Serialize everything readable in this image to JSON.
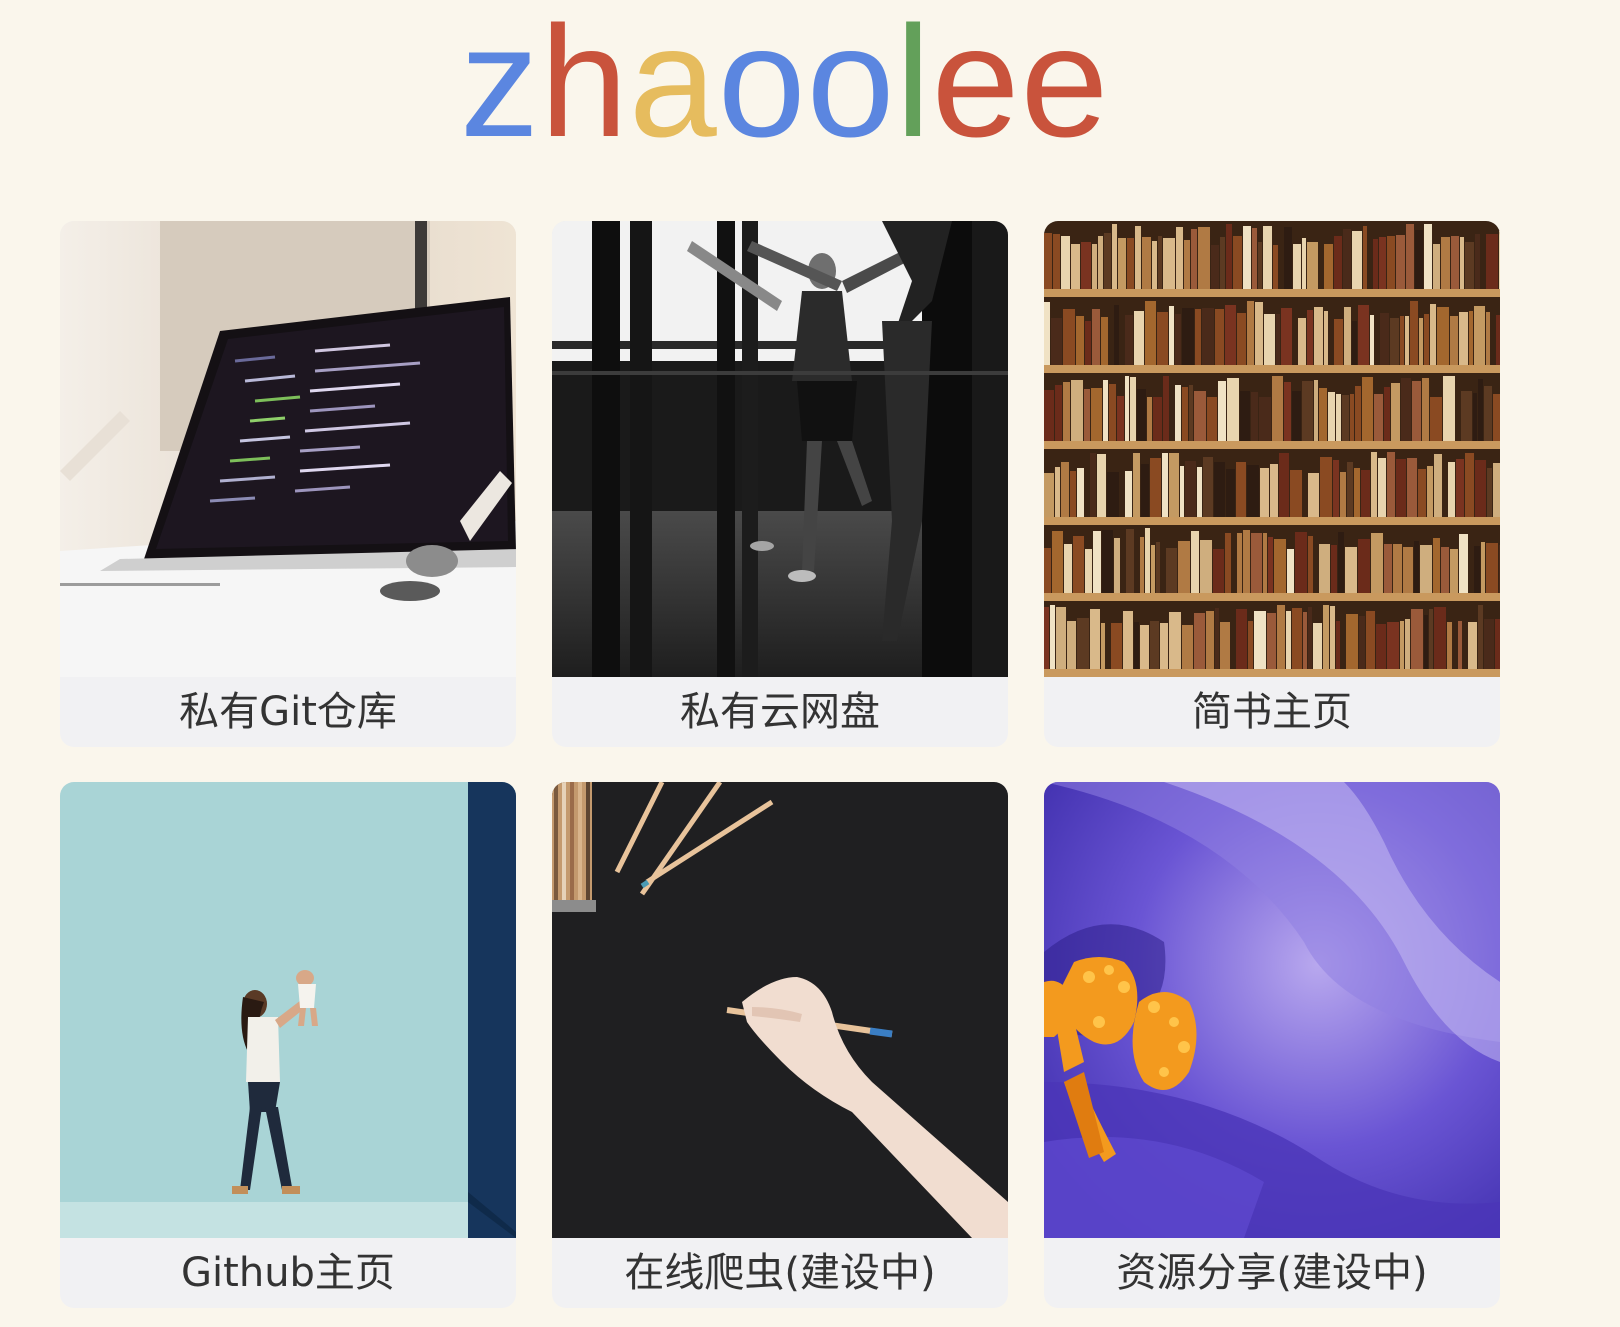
{
  "logo": {
    "letters": [
      {
        "char": "z",
        "color": "#5b86e0"
      },
      {
        "char": "h",
        "color": "#c9533c"
      },
      {
        "char": "a",
        "color": "#e6bc5e"
      },
      {
        "char": "o",
        "color": "#5b86e0"
      },
      {
        "char": "o",
        "color": "#5b86e0"
      },
      {
        "char": "l",
        "color": "#63a05a"
      },
      {
        "char": "e",
        "color": "#c9533c"
      },
      {
        "char": "e",
        "color": "#c9533c"
      }
    ]
  },
  "cards": [
    {
      "label": "私有Git仓库",
      "image": "laptop-code-photo"
    },
    {
      "label": "私有云网盘",
      "image": "ballet-dancers-photo"
    },
    {
      "label": "简书主页",
      "image": "bookshelf-photo"
    },
    {
      "label": "Github主页",
      "image": "mother-baby-photo"
    },
    {
      "label": "在线爬虫(建设中)",
      "image": "hand-pencil-photo"
    },
    {
      "label": "资源分享(建设中)",
      "image": "purple-flower-photo"
    }
  ],
  "colors": {
    "background": "#faf6ec",
    "card": "#f1f1f3",
    "label_text": "#333333"
  }
}
